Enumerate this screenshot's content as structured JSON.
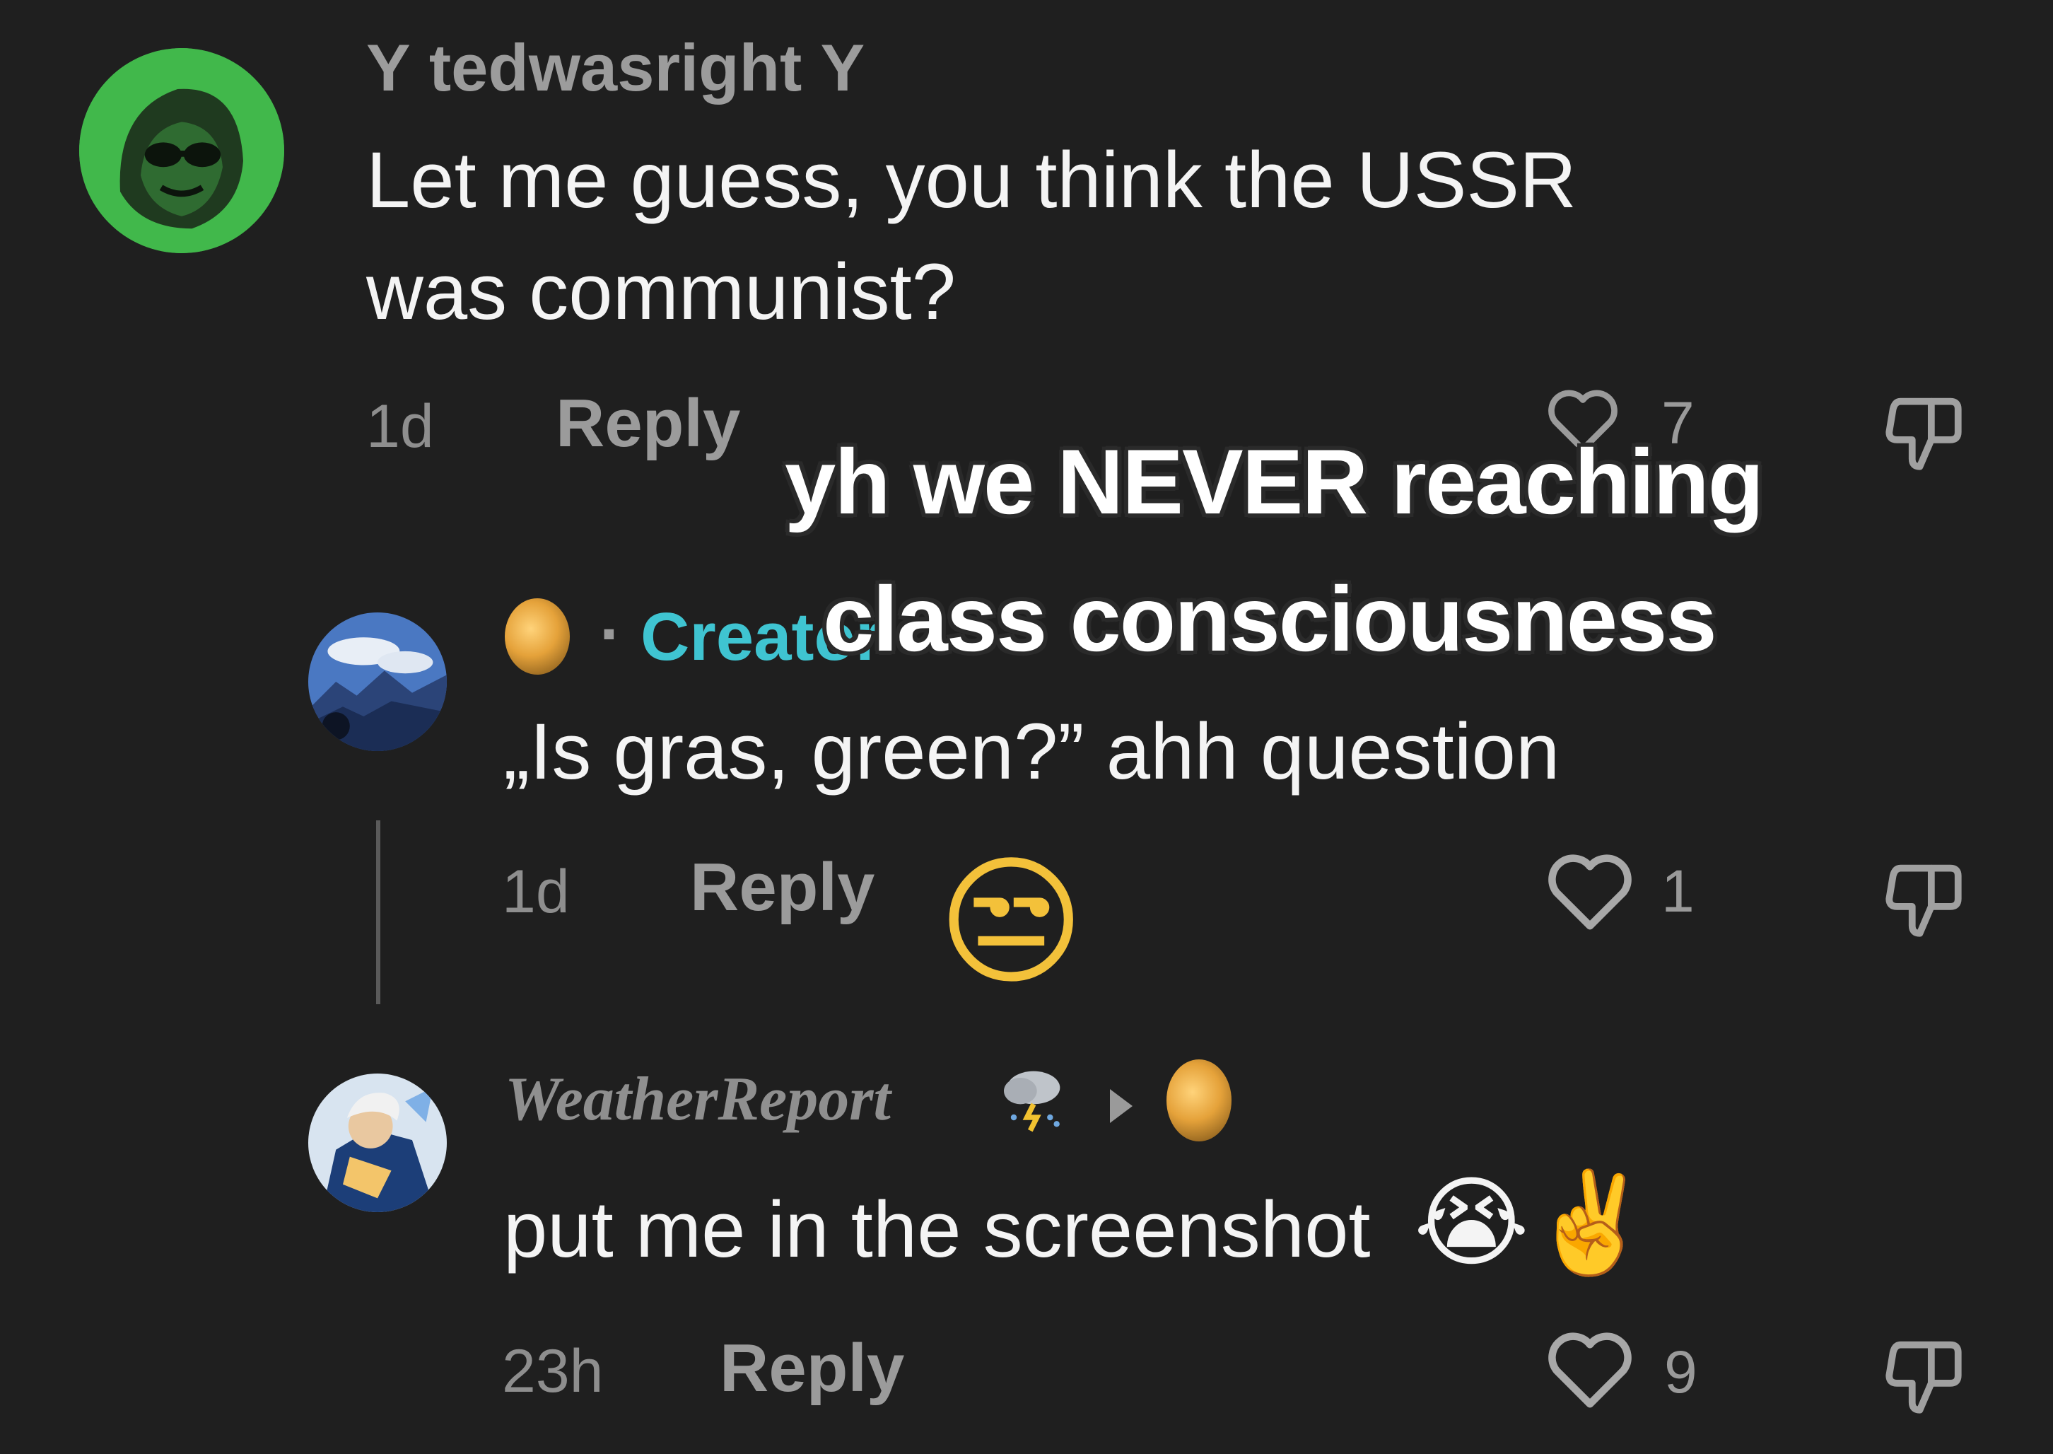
{
  "comments": [
    {
      "username": "Υ tedwasright Υ",
      "text_line1": "Let me guess, you think the USSR",
      "text_line2": "was communist?",
      "time": "1d",
      "reply_label": "Reply",
      "likes": "7",
      "avatar": "green-hooded-sketch"
    },
    {
      "creator_dot": "·",
      "creator_label": "Creator",
      "text": "„Is gras, green?” ahh question",
      "time": "1d",
      "reply_label": "Reply",
      "likes": "1",
      "reaction_emoji": "😒",
      "avatar": "sky-mountain"
    },
    {
      "username": "WeatherReport",
      "text": "put me in the screenshot",
      "text_emojis": "😭✌️",
      "time": "23h",
      "reply_label": "Reply",
      "likes": "9",
      "avatar": "anime-character"
    }
  ],
  "overlay_caption": {
    "line1": "yh we NEVER reaching",
    "line2": "class consciousness"
  },
  "colors": {
    "background": "#1f1f1f",
    "creator_accent": "#3fc4d1",
    "avatar_green": "#3fb94a"
  }
}
